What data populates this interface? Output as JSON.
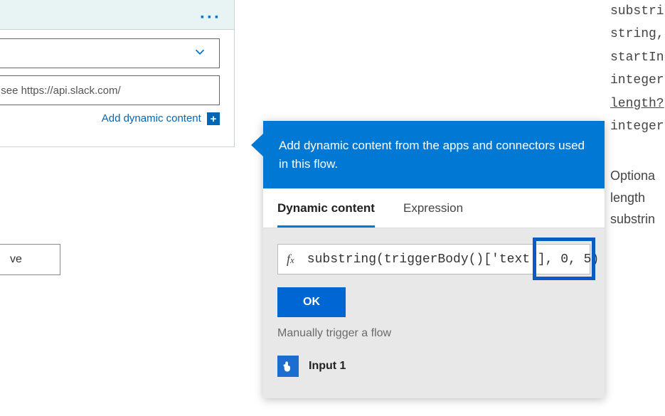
{
  "action_card": {
    "dropdown_value": "",
    "text_input_placeholder": "tting options, see https://api.slack.com/",
    "add_dynamic_label": "Add dynamic content"
  },
  "save_button_label": "ve",
  "flyout": {
    "header": "Add dynamic content from the apps and connectors used in this flow.",
    "tabs": {
      "dynamic": "Dynamic content",
      "expression": "Expression",
      "active": "dynamic"
    },
    "fx_label": "f",
    "fx_sub": "x",
    "expression_text": "substring(triggerBody()['text'], 0, 5)",
    "ok_label": "OK",
    "section_title": "Manually trigger a flow",
    "items": [
      {
        "label": "Input 1",
        "icon": "touch-icon"
      }
    ]
  },
  "syntax_panel": {
    "lines": [
      "substri",
      "string,",
      "startIn",
      "integer",
      "length?",
      "integer"
    ]
  },
  "syntax_desc": {
    "lines": [
      "Optiona",
      "length",
      "substrin"
    ]
  }
}
